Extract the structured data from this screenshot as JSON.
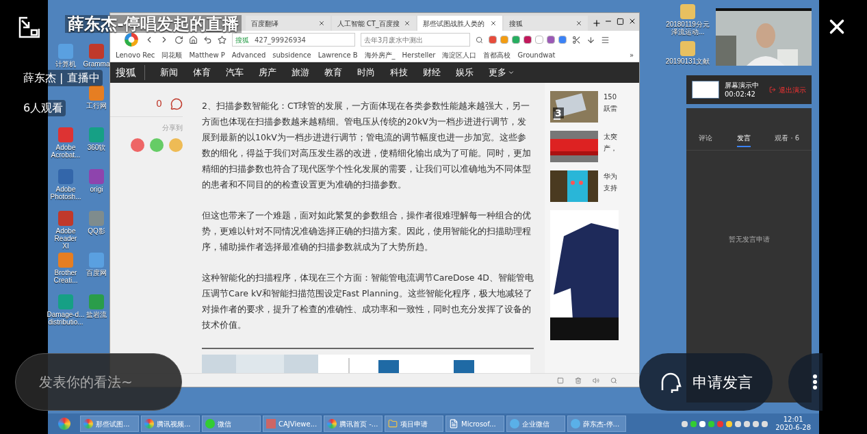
{
  "stream": {
    "title": "薛东杰-停唱发起的直播",
    "host_status": "薛东杰 | 直播中",
    "viewers": "6人观看",
    "comment_placeholder": "发表你的看法~",
    "request_button": "申请发言"
  },
  "desktop": {
    "icon_rows": [
      {
        "left": "计算机",
        "right": "Gramma"
      },
      {
        "right": "工行网"
      },
      {
        "left": "Adobe Acrobat...",
        "right": "360软"
      },
      {
        "left": "Adobe Photosh...",
        "right": "origi"
      },
      {
        "left": "Adobe Reader XI",
        "right": "QQ影"
      },
      {
        "left": "Brother Creati...",
        "right": "百度网"
      },
      {
        "left": "Damage-d... distributio...",
        "right": "盐岩流"
      }
    ],
    "icons_right": [
      "20180119分元泽流运动...",
      "20190131文献"
    ]
  },
  "browser": {
    "tabs": [
      {
        "label": "百度翻译",
        "selected": false
      },
      {
        "label": "人工智能 CT_百度搜",
        "selected": false
      },
      {
        "label": "那些试图战胜人类的",
        "selected": true
      },
      {
        "label": "搜狐",
        "selected": false
      }
    ],
    "address": "427_99926934",
    "site_badge": "搜狐",
    "search": "去年3月废水中测出",
    "bookmarks": [
      "Lenovo Rec",
      "同花顺",
      "Matthew P",
      "Advanced",
      "subsidence",
      "Lawrence B",
      "海外房产_",
      "Hersteller",
      "海淀区人口",
      "首都高校",
      "Groundwat"
    ],
    "bookmarks_more": "»",
    "site_logo": "搜狐",
    "nav": [
      "新闻",
      "体育",
      "汽车",
      "房产",
      "旅游",
      "教育",
      "时尚",
      "科技",
      "财经",
      "娱乐",
      "更多"
    ],
    "comment_count": "0",
    "share_label": "分享到",
    "paragraphs": [
      "2、扫描参数智能化：CT球管的发展，一方面体现在各类参数性能越来越强大，另一方面也体现在扫描参数越来越精细。管电压从传统的20kV为一档步进进行调节，发展到最新的以10kV为一档步进进行调节；管电流的调节幅度也进一步加宽。这些参数的细化，得益于我们对高压发生器的改进，使精细化输出成为了可能。同时，更加精细的扫描参数也符合了现代医学个性化发展的需要，让我们可以准确地为不同体型的患者和不同目的的检查设置更为准确的扫描参数。",
      "但这也带来了一个难题，面对如此繁复的参数组合，操作者很难理解每一种组合的优势，更难以针对不同情况准确选择正确的扫描方案。因此，使用智能化的扫描助理程序，辅助操作者选择最准确的扫描参数就成为了大势所趋。",
      "这种智能化的扫描程序，体现在三个方面：智能管电流调节CareDose 4D、智能管电压调节Care kV和智能扫描范围设定Fast Planning。这些智能化程序，极大地减轻了对操作者的要求，提升了检查的准确性、成功率和一致性，同时也充分发挥了设备的技术价值。"
    ],
    "side_news": [
      {
        "badge": "3",
        "lines": [
          "150",
          "跃雷"
        ]
      },
      {
        "lines": [
          "太突",
          "产，"
        ]
      },
      {
        "lines": [
          "华为",
          "支持"
        ]
      }
    ]
  },
  "presenting": {
    "status": "屏幕演示中",
    "elapsed": "00:02:42",
    "exit": "退出演示"
  },
  "panel": {
    "tabs": [
      {
        "label": "评论",
        "selected": false
      },
      {
        "label": "发言",
        "selected": true
      },
      {
        "label": "观看 · 6",
        "selected": false
      }
    ],
    "empty": "暂无发言申请"
  },
  "taskbar": {
    "items": [
      {
        "label": "那些试图...",
        "kind": "chrome"
      },
      {
        "label": "腾讯视频...",
        "kind": "chrome"
      },
      {
        "label": "微信",
        "kind": "wechat"
      },
      {
        "label": "CAJViewe...",
        "kind": "caj"
      },
      {
        "label": "腾讯首页 -...",
        "kind": "chrome"
      },
      {
        "label": "项目申请",
        "kind": "folder"
      },
      {
        "label": "Microsof...",
        "kind": "word"
      },
      {
        "label": "企业微信",
        "kind": "wework"
      },
      {
        "label": "薛东杰-停...",
        "kind": "wework"
      }
    ],
    "time": "12:01",
    "date": "2020-6-28"
  }
}
